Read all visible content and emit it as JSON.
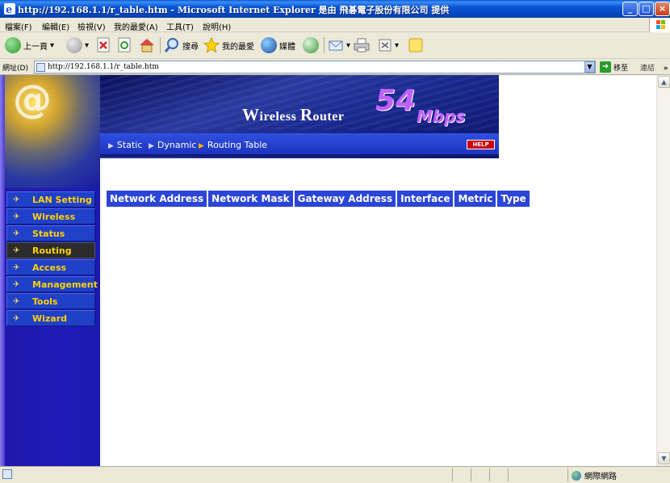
{
  "window": {
    "title": "http://192.168.1.1/r_table.htm - Microsoft Internet Explorer 是由 飛碁電子股份有限公司 提供",
    "buttons": {
      "minimize": "_",
      "maximize": "□",
      "close": "×"
    }
  },
  "menu": {
    "items": [
      "檔案(F)",
      "編輯(E)",
      "檢視(V)",
      "我的最愛(A)",
      "工具(T)",
      "說明(H)"
    ]
  },
  "toolbar": {
    "back_label": "上一頁",
    "search_label": "搜尋",
    "favorites_label": "我的最愛",
    "media_label": "媒體"
  },
  "address": {
    "label": "網址(D)",
    "url": "http://192.168.1.1/r_table.htm",
    "go_label": "移至",
    "links_label": "連結",
    "more": "»"
  },
  "nav": {
    "items": [
      {
        "label": "LAN Setting",
        "active": false
      },
      {
        "label": "Wireless",
        "active": false
      },
      {
        "label": "Status",
        "active": false
      },
      {
        "label": "Routing",
        "active": true
      },
      {
        "label": "Access",
        "active": false
      },
      {
        "label": "Management",
        "active": false
      },
      {
        "label": "Tools",
        "active": false
      },
      {
        "label": "Wizard",
        "active": false
      }
    ]
  },
  "banner": {
    "brand_w": "W",
    "brand_ireless": "ireless ",
    "brand_r": "R",
    "brand_outer": "outer",
    "speed": "54",
    "unit": "Mbps",
    "help": "HELP"
  },
  "subnav": {
    "items": [
      {
        "label": "Static",
        "active": false
      },
      {
        "label": "Dynamic",
        "active": false
      },
      {
        "label": "Routing Table",
        "active": true
      }
    ]
  },
  "routing_table": {
    "columns": [
      "Network Address",
      "Network Mask",
      "Gateway Address",
      "Interface",
      "Metric",
      "Type"
    ],
    "rows": []
  },
  "statusbar": {
    "zone": "網際網路"
  }
}
